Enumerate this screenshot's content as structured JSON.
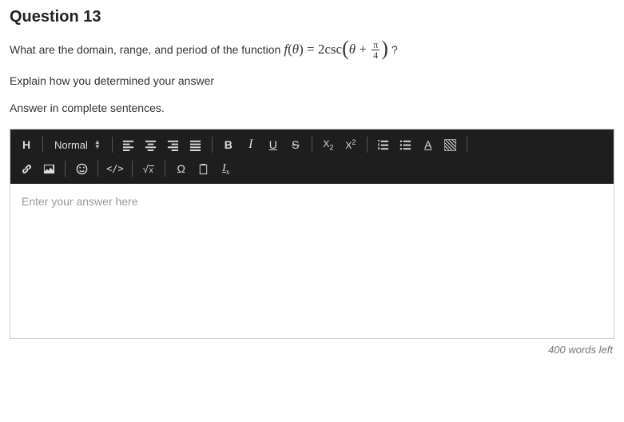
{
  "question": {
    "title": "Question 13",
    "prompt_prefix": "What are the domain, range, and period of the function",
    "formula": {
      "lhs": "f(θ) = 2csc",
      "inside_var": "θ",
      "plus": "+",
      "frac_num": "π",
      "frac_den": "4"
    },
    "prompt_suffix": "?",
    "line2": "Explain how you determined your answer",
    "line3": "Answer in complete sentences."
  },
  "toolbar": {
    "heading": "H",
    "format_label": "Normal",
    "bold": "B",
    "italic": "I",
    "underline": "U",
    "strike": "S",
    "subscript": "X",
    "superscript": "X",
    "text_color": "A",
    "sqrt": "x",
    "omega": "Ω",
    "clear_fmt": "x"
  },
  "editor": {
    "placeholder": "Enter your answer here",
    "value": ""
  },
  "footer": {
    "word_count_text": "400 words left"
  }
}
